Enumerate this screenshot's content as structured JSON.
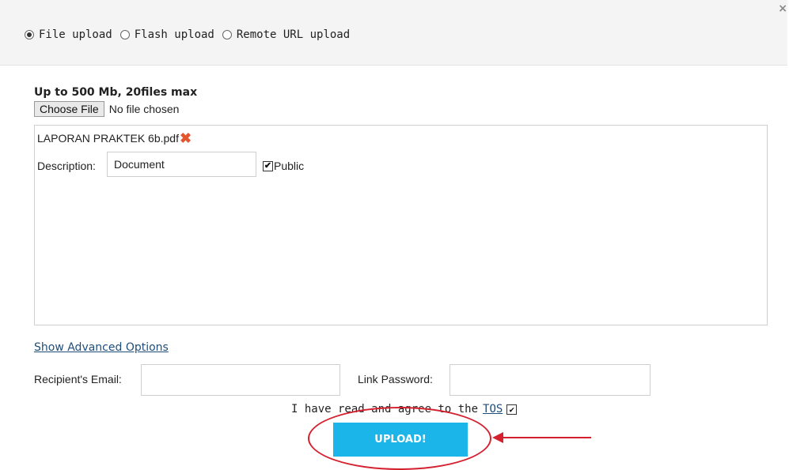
{
  "header": {
    "upload_modes": [
      {
        "label": "File upload",
        "selected": true
      },
      {
        "label": "Flash upload",
        "selected": false
      },
      {
        "label": "Remote URL upload",
        "selected": false
      }
    ],
    "close_glyph": "×"
  },
  "limits": "Up to 500 Mb, 20files max",
  "file_input": {
    "button_label": "Choose File",
    "status": "No file chosen"
  },
  "file_entry": {
    "filename": "LAPORAN PRAKTEK 6b.pdf",
    "description_label": "Description:",
    "description_value": "Document",
    "public_label": "Public",
    "public_checked": true
  },
  "advanced_link": "Show Advanced Options",
  "recipient_label": "Recipient's Email:",
  "password_label": "Link Password:",
  "tos": {
    "prefix": "I have read and agree to the",
    "link": "TOS",
    "checked": true
  },
  "upload_button": "UPLOAD!",
  "colors": {
    "upload_bg": "#1cb5e9",
    "annotation": "#d4202f",
    "remove_icon": "#e4572e"
  }
}
